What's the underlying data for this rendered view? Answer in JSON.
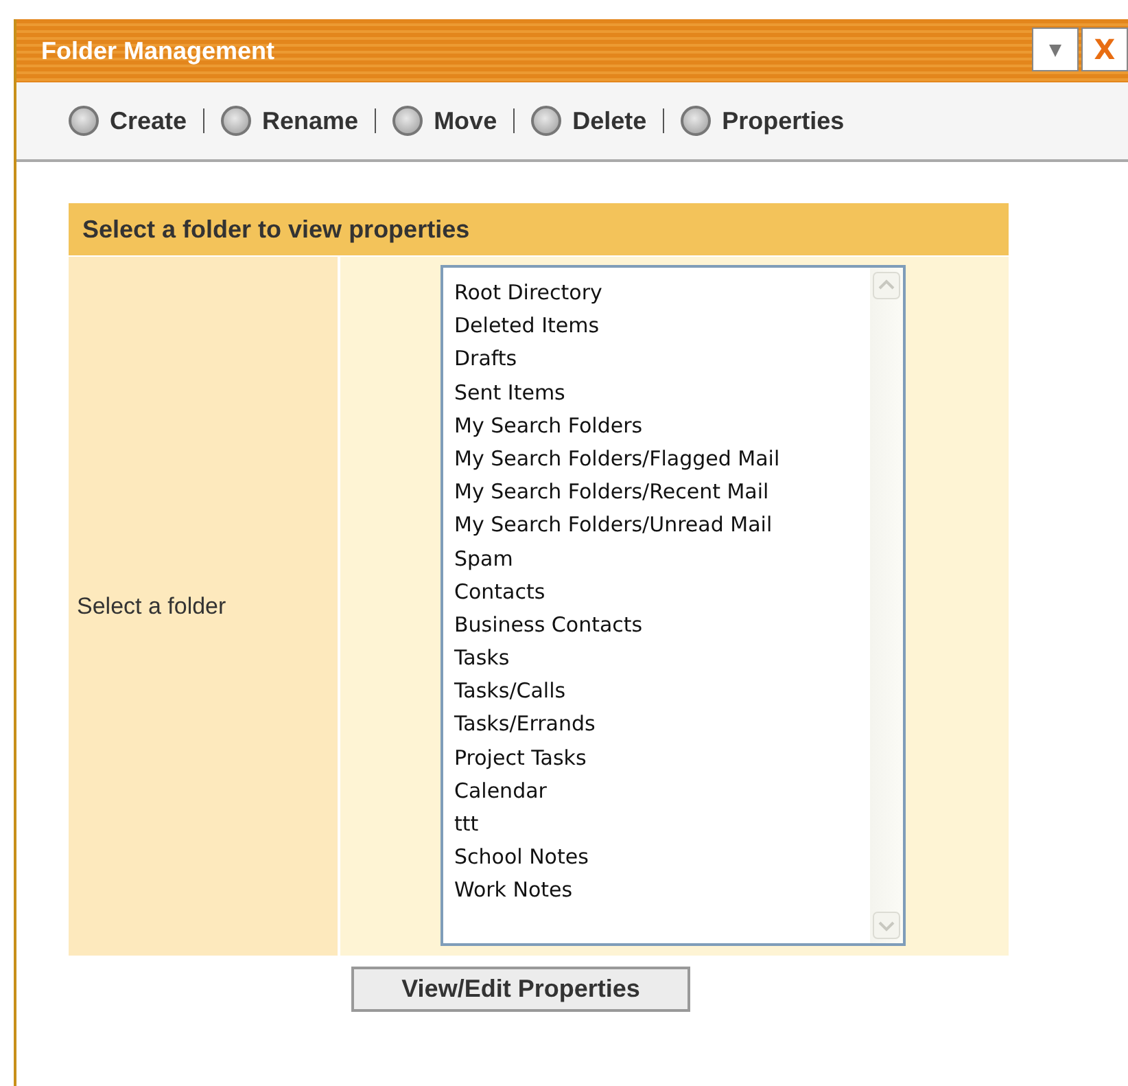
{
  "window": {
    "title": "Folder Management",
    "menu_button": "▾",
    "close_button": "X"
  },
  "toolbar": [
    {
      "label": "Create",
      "selected": false
    },
    {
      "label": "Rename",
      "selected": false
    },
    {
      "label": "Move",
      "selected": false
    },
    {
      "label": "Delete",
      "selected": false
    },
    {
      "label": "Properties",
      "selected": false
    }
  ],
  "panel": {
    "heading": "Select a folder to view properties",
    "field_label": "Select a folder",
    "folders": [
      {
        "name": "Root Directory",
        "selected": false
      },
      {
        "name": "Deleted Items",
        "selected": false
      },
      {
        "name": "Drafts",
        "selected": false
      },
      {
        "name": "Sent Items",
        "selected": false
      },
      {
        "name": "My Search Folders",
        "selected": false
      },
      {
        "name": "My Search Folders/Flagged Mail",
        "selected": false
      },
      {
        "name": "My Search Folders/Recent Mail",
        "selected": false
      },
      {
        "name": "My Search Folders/Unread Mail",
        "selected": false
      },
      {
        "name": "Spam",
        "selected": false
      },
      {
        "name": "Contacts",
        "selected": false
      },
      {
        "name": "Business Contacts",
        "selected": false
      },
      {
        "name": "Tasks",
        "selected": false
      },
      {
        "name": "Tasks/Calls",
        "selected": false
      },
      {
        "name": "Tasks/Errands",
        "selected": false
      },
      {
        "name": "Project Tasks",
        "selected": false
      },
      {
        "name": "Calendar",
        "selected": false
      },
      {
        "name": "ttt",
        "selected": false
      },
      {
        "name": "School Notes",
        "selected": false
      },
      {
        "name": "Work Notes",
        "selected": false
      }
    ]
  },
  "button": "View/Edit Properties"
}
